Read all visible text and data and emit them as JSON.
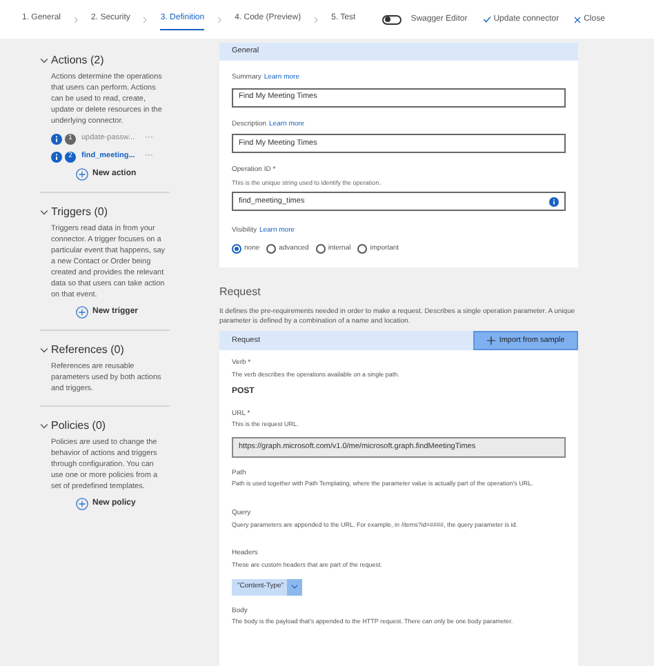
{
  "steps": [
    {
      "label": "1. General",
      "selected": false
    },
    {
      "label": "2. Security",
      "selected": false
    },
    {
      "label": "3. Definition",
      "selected": true
    },
    {
      "label": "4. Code (Preview)",
      "selected": false
    },
    {
      "label": "5. Test",
      "selected": false
    }
  ],
  "swagger_editor": {
    "label": "Swagger Editor",
    "on": false
  },
  "update_connector": "Update connector",
  "close": "Close",
  "sidebar": {
    "sections": [
      {
        "title": "Actions (2)",
        "expanded": true,
        "description": "Actions determine the operations that users can perform. Actions can be used to read, create, update or delete resources in the underlying connector.",
        "items": [
          {
            "badge": "1",
            "name": "update-passw...",
            "selected": false,
            "more": "···"
          },
          {
            "badge": "2",
            "name": "find_meeting...",
            "selected": true,
            "more": "···"
          }
        ],
        "add_label": "New action"
      },
      {
        "title": "Triggers (0)",
        "expanded": true,
        "description": "Triggers read data in from your connector. A trigger focuses on a particular event that happens, say a new Contact or Order being created and provides the relevant data so that users can take action on that event.",
        "add_label": "New trigger"
      },
      {
        "title": "References (0)",
        "expanded": true,
        "description": "References are reusable parameters used by both actions and triggers."
      },
      {
        "title": "Policies (0)",
        "expanded": true,
        "description": "Policies are used to change the behavior of actions and triggers through configuration. You can use one or more policies from a set of predefined templates.",
        "add_label": "New policy"
      }
    ]
  },
  "general": {
    "header": "General",
    "fields": [
      {
        "kind": "text",
        "label": "Summary",
        "link": "Learn more",
        "value": "Find My Meeting Times"
      },
      {
        "kind": "text",
        "label": "Description",
        "link": "Learn more",
        "value": "Find My Meeting Times"
      },
      {
        "kind": "info",
        "label": "Operation ID *",
        "hint": "This is the unique string used to identify the operation.",
        "value": "find_meeting_times"
      }
    ],
    "visibility": {
      "label": "Visibility",
      "link": "Learn more",
      "options": [
        {
          "label": "none",
          "selected": true
        },
        {
          "label": "advanced",
          "selected": false
        },
        {
          "label": "internal",
          "selected": false
        },
        {
          "label": "important",
          "selected": false
        }
      ]
    }
  },
  "request": {
    "title": "Request",
    "description": "It defines the pre-requirements needed in order to make a request. Describes a single operation parameter. A unique parameter is defined by a combination of a name and location.",
    "header": "Request",
    "import_button": "Import from sample",
    "params": [
      {
        "kind": "value",
        "label": "Verb *",
        "hint": "The verb describes the operations available on a single path.",
        "value": "POST"
      },
      {
        "kind": "field",
        "label": "URL *",
        "hint": "This is the request URL.",
        "value": "https://graph.microsoft.com/v1.0/me/microsoft.graph.findMeetingTimes"
      },
      {
        "kind": "plain",
        "label": "Path",
        "hint": "Path is used together with Path Templating, where the parameter value is actually part of the operation's URL."
      },
      {
        "kind": "plain",
        "label": "Query",
        "hint": "Query parameters are appended to the URL. For example, in /items?id=####, the query parameter is id."
      },
      {
        "kind": "chip",
        "label": "Headers",
        "hint": "These are custom headers that are part of the request.",
        "value": "\"Content-Type\""
      },
      {
        "kind": "plain",
        "label": "Body",
        "hint": "The body is the payload that's appended to the HTTP request. There can only be one body parameter."
      }
    ]
  }
}
